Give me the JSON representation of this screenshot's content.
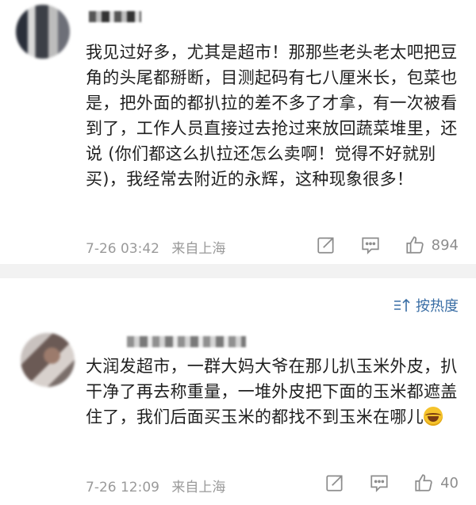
{
  "comments": [
    {
      "text": "我见过好多，尤其是超市！那那些老头老太吧把豆角的头尾都掰断，目测起码有七八厘米长，包菜也是，把外面的都扒拉的差不多了才拿，有一次被看到了，工作人员直接过去抢过来放回蔬菜堆里，还说 (你们都这么扒拉还怎么卖啊！觉得不好就别买)，我经常去附近的永辉，这种现象很多！",
      "date": "7-26 03:42",
      "location": "来自上海",
      "likes": "894"
    },
    {
      "text": "大润发超市，一群大妈大爷在那儿扒玉米外皮，扒干净了再去称重量，一堆外皮把下面的玉米都遮盖住了，我们后面买玉米的都找不到玉米在哪儿",
      "date": "7-26 12:09",
      "location": "来自上海",
      "likes": "40"
    }
  ],
  "sort": {
    "label": "按热度"
  },
  "icons": {
    "share": "share-icon",
    "reply": "comment-icon",
    "like": "thumbs-up-icon",
    "sort": "sort-icon",
    "emoji": "laughing-tears-emoji"
  },
  "colors": {
    "accent": "#3a6ea5",
    "meta": "#9a9a9a",
    "separator": "#f2f2f2"
  }
}
